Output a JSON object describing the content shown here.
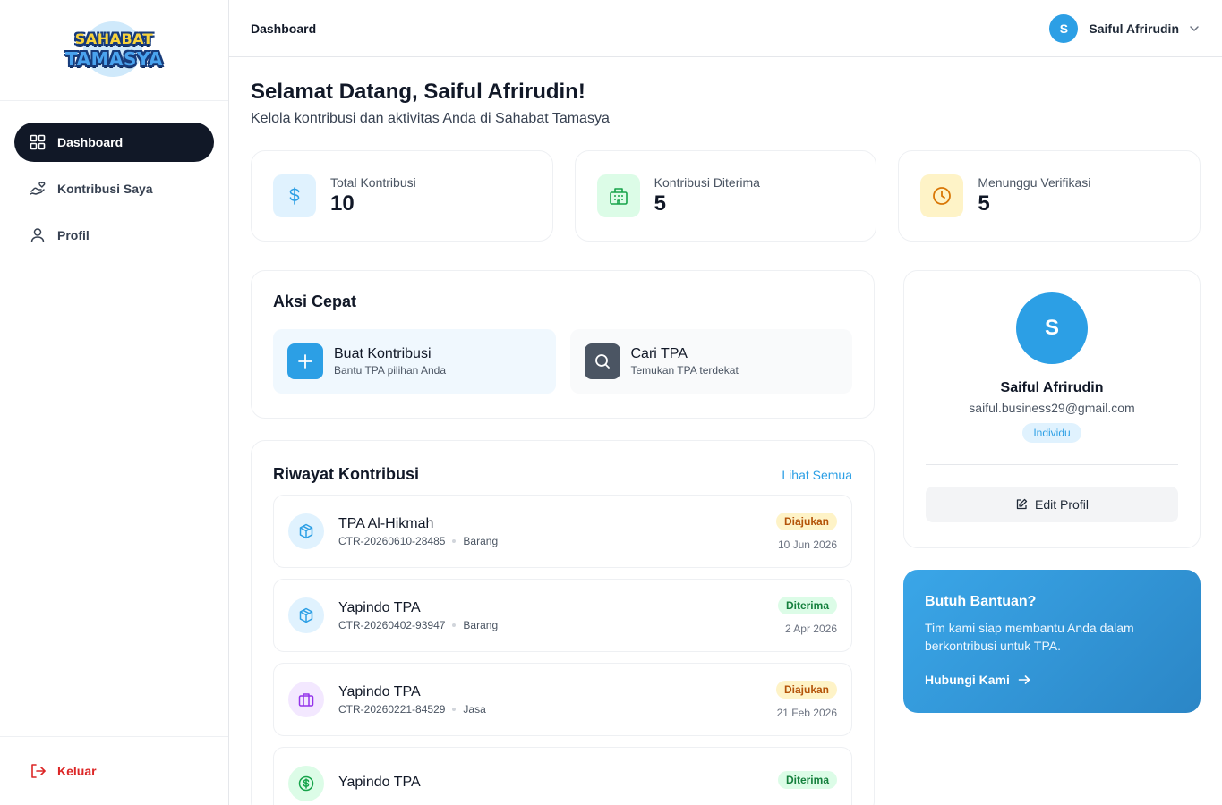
{
  "app": {
    "logo_line1": "SAHABAT",
    "logo_line2": "TAMASYA"
  },
  "sidebar": {
    "items": [
      {
        "label": "Dashboard",
        "icon": "grid-icon",
        "active": true
      },
      {
        "label": "Kontribusi Saya",
        "icon": "hand-heart-icon",
        "active": false
      },
      {
        "label": "Profil",
        "icon": "user-icon",
        "active": false
      }
    ],
    "logout_label": "Keluar"
  },
  "header": {
    "breadcrumb": "Dashboard",
    "user_initial": "S",
    "user_name": "Saiful Afrirudin"
  },
  "welcome": {
    "title": "Selamat Datang, Saiful Afrirudin!",
    "subtitle": "Kelola kontribusi dan aktivitas Anda di Sahabat Tamasya"
  },
  "stats": [
    {
      "label": "Total Kontribusi",
      "value": "10",
      "icon": "dollar-icon",
      "color": "#2c9fe5"
    },
    {
      "label": "Kontribusi Diterima",
      "value": "5",
      "icon": "building-icon",
      "color": "#16a34a"
    },
    {
      "label": "Menunggu Verifikasi",
      "value": "5",
      "icon": "clock-icon",
      "color": "#d97706"
    }
  ],
  "quick_actions": {
    "title": "Aksi Cepat",
    "items": [
      {
        "title": "Buat Kontribusi",
        "subtitle": "Bantu TPA pilihan Anda",
        "icon": "plus-icon"
      },
      {
        "title": "Cari TPA",
        "subtitle": "Temukan TPA terdekat",
        "icon": "search-icon"
      }
    ]
  },
  "history": {
    "title": "Riwayat Kontribusi",
    "see_all": "Lihat Semua",
    "rows": [
      {
        "name": "TPA Al-Hikmah",
        "code": "CTR-20260610-28485",
        "type": "Barang",
        "status": "Diajukan",
        "date": "10 Jun 2026",
        "icon": "box-icon"
      },
      {
        "name": "Yapindo TPA",
        "code": "CTR-20260402-93947",
        "type": "Barang",
        "status": "Diterima",
        "date": "2 Apr 2026",
        "icon": "box-icon"
      },
      {
        "name": "Yapindo TPA",
        "code": "CTR-20260221-84529",
        "type": "Jasa",
        "status": "Diajukan",
        "date": "21 Feb 2026",
        "icon": "briefcase-icon"
      },
      {
        "name": "Yapindo TPA",
        "code": "",
        "type": "",
        "status": "Diterima",
        "date": "",
        "icon": "coin-icon"
      }
    ]
  },
  "profile": {
    "initial": "S",
    "name": "Saiful Afrirudin",
    "email": "saiful.business29@gmail.com",
    "type": "Individu",
    "edit_label": "Edit Profil"
  },
  "help": {
    "title": "Butuh Bantuan?",
    "description": "Tim kami siap membantu Anda dalam berkontribusi untuk TPA.",
    "link_label": "Hubungi Kami"
  }
}
